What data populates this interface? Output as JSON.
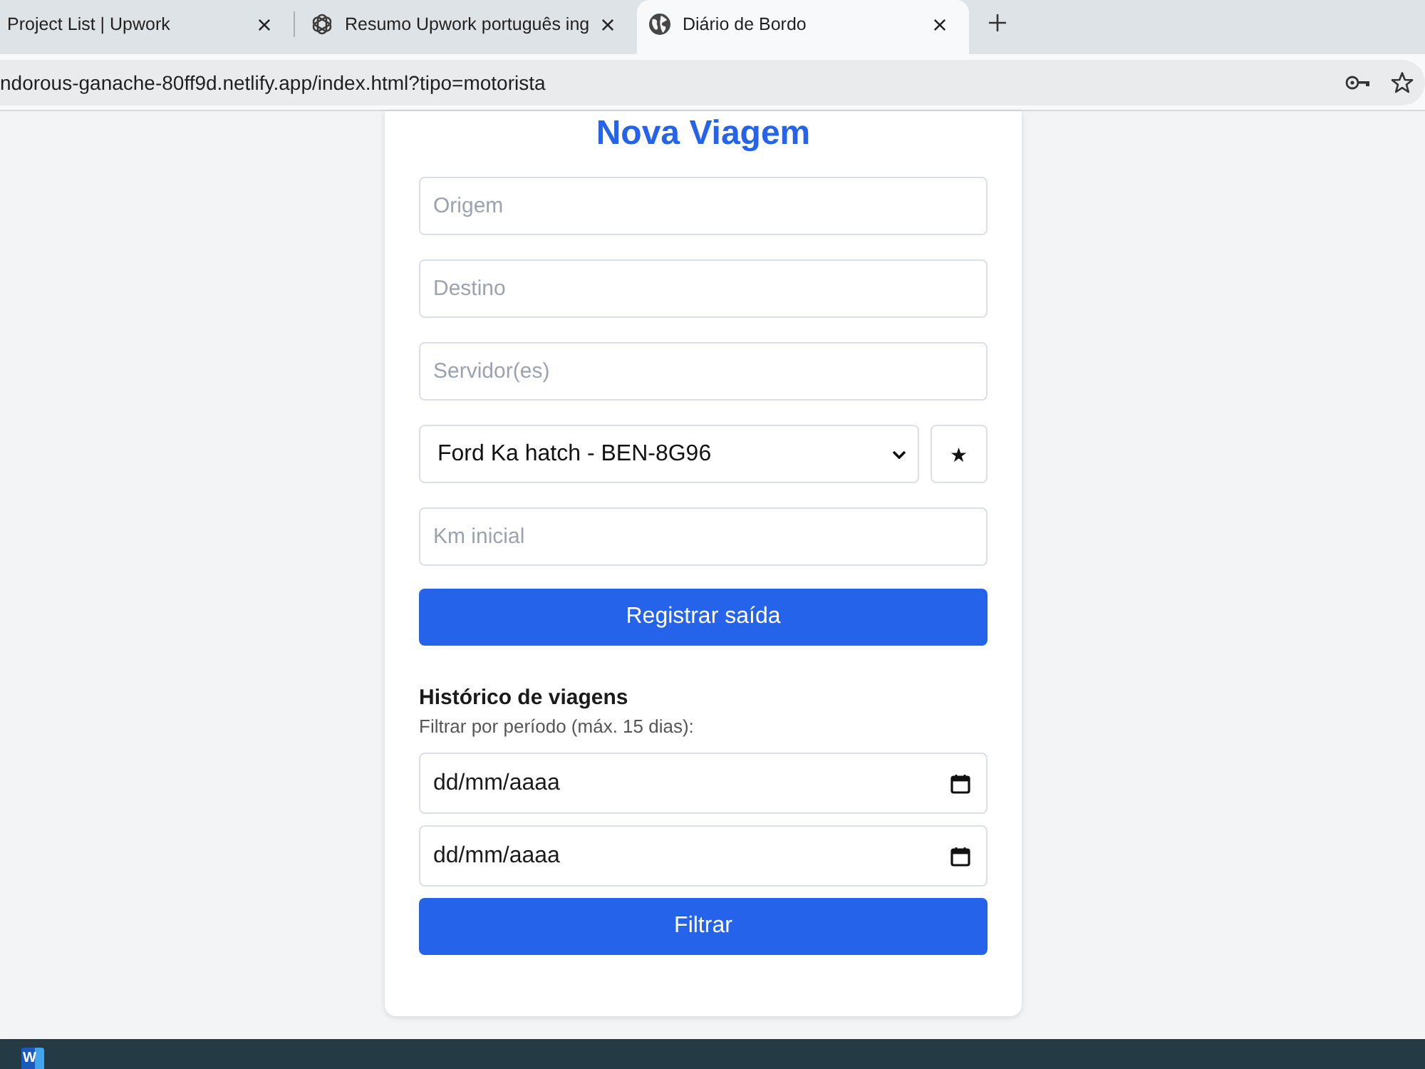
{
  "browser": {
    "tabs": [
      {
        "title": "Project List | Upwork",
        "selected": false
      },
      {
        "title": "Resumo Upwork português ing",
        "selected": false
      },
      {
        "title": "Diário de Bordo",
        "selected": true
      }
    ],
    "url": "ndorous-ganache-80ff9d.netlify.app/index.html?tipo=motorista"
  },
  "form": {
    "title": "Nova Viagem",
    "fields": [
      {
        "kind": "text",
        "placeholder": "Origem"
      },
      {
        "kind": "text",
        "placeholder": "Destino"
      },
      {
        "kind": "text",
        "placeholder": "Servidor(es)"
      },
      {
        "kind": "select",
        "value": "Ford Ka hatch - BEN-8G96",
        "button": "★"
      },
      {
        "kind": "text",
        "placeholder": "Km inicial"
      }
    ],
    "submit": "Registrar saída"
  },
  "history": {
    "title": "Histórico de viagens",
    "hint": "Filtrar por período (máx. 15 dias):",
    "date_fields": [
      {
        "placeholder": "dd/mm/aaaa"
      },
      {
        "placeholder": "dd/mm/aaaa"
      }
    ],
    "filter_button": "Filtrar"
  },
  "taskbar": {
    "apps": [
      {
        "label": "W"
      }
    ]
  }
}
